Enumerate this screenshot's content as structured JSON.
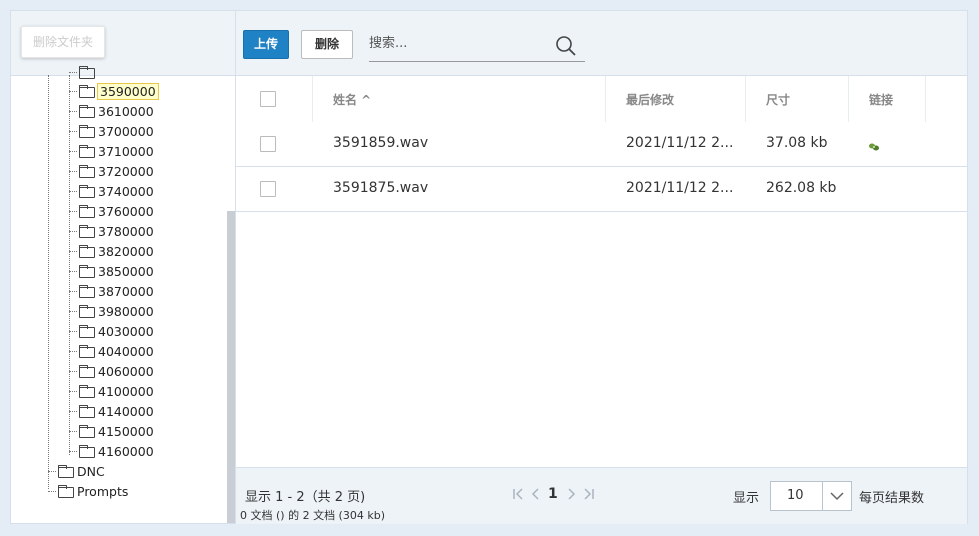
{
  "left_panel": {
    "delete_folder_label": "删除文件夹",
    "tree_items": [
      {
        "label": ""
      },
      {
        "label": "3590000",
        "selected": true
      },
      {
        "label": "3610000"
      },
      {
        "label": "3700000"
      },
      {
        "label": "3710000"
      },
      {
        "label": "3720000"
      },
      {
        "label": "3740000"
      },
      {
        "label": "3760000"
      },
      {
        "label": "3780000"
      },
      {
        "label": "3820000"
      },
      {
        "label": "3850000"
      },
      {
        "label": "3870000"
      },
      {
        "label": "3980000"
      },
      {
        "label": "4030000"
      },
      {
        "label": "4040000"
      },
      {
        "label": "4060000"
      },
      {
        "label": "4100000"
      },
      {
        "label": "4140000"
      },
      {
        "label": "4150000"
      },
      {
        "label": "4160000"
      }
    ],
    "top_folders": [
      {
        "label": "DNC"
      },
      {
        "label": "Prompts"
      }
    ]
  },
  "toolbar": {
    "upload_label": "上传",
    "delete_label": "删除",
    "search_placeholder": "搜索..."
  },
  "table": {
    "headers": {
      "name": "姓名 ^",
      "modified": "最后修改",
      "size": "尺寸",
      "link": "链接"
    },
    "rows": [
      {
        "name": "3591859.wav",
        "modified": "2021/11/12 2...",
        "size": "37.08 kb",
        "has_link_icon": true
      },
      {
        "name": "3591875.wav",
        "modified": "2021/11/12 2...",
        "size": "262.08 kb",
        "has_link_icon": false
      }
    ]
  },
  "footer": {
    "display_range": "显示 1 - 2（共 2 页)",
    "summary": "0 文档 () 的 2 文档 (304 kb)",
    "current_page": "1",
    "show_label": "显示",
    "page_size": "10",
    "per_page_label": "每页结果数"
  },
  "icons": {
    "folder": "folder-icon",
    "search": "search-icon",
    "link": "link-icon",
    "first": "first-page-icon",
    "prev": "prev-page-icon",
    "next": "next-page-icon",
    "last": "last-page-icon",
    "dropdown": "chevron-down-icon"
  },
  "colors": {
    "accent": "#1f82c5",
    "panel_bg": "#eef3f8",
    "page_bg": "#e4edf5",
    "selected_bg": "#ffffcc"
  }
}
